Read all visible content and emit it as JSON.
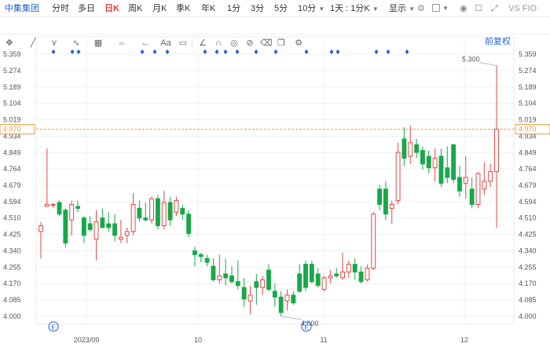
{
  "toolbar": {
    "stock_name": "中集集团",
    "periods": [
      "分时",
      "多日",
      "日K",
      "周K",
      "月K",
      "季K",
      "年K",
      "1分",
      "3分",
      "5分",
      "10分"
    ],
    "active_period": "日K",
    "dropdown_10": "10分",
    "range_select": "1天 : 1分K",
    "show_label": "显示",
    "vs_label": "VS",
    "compare_code": "FIO"
  },
  "draw_tools": {
    "icons": [
      "move-icon",
      "line-icon",
      "channel-icon",
      "wave-icon",
      "grid-icon",
      "arrow-icon",
      "horizontal-line-icon",
      "back-arrow-icon",
      "text-icon",
      "comment-icon",
      "angle-icon",
      "magnet-icon",
      "eye-icon",
      "ban-icon",
      "trash-icon",
      "copy-icon",
      "settings-icon"
    ]
  },
  "adjust_button": "前复权",
  "colors": {
    "up": "#e94545",
    "down": "#18a84a",
    "current_line": "#f39c3c",
    "accent": "#1e62d6"
  },
  "chart_data": {
    "type": "candlestick",
    "yticks": [
      "5.359",
      "5.274",
      "5.189",
      "5.104",
      "5.019",
      "4.934",
      "4.849",
      "4.764",
      "4.679",
      "4.594",
      "4.510",
      "4.425",
      "4.340",
      "4.255",
      "4.170",
      "4.085",
      "4.000"
    ],
    "ylim": [
      4.0,
      5.359
    ],
    "current_price": "4.970",
    "x_labels": [
      "2023/09",
      "10",
      "11",
      "12"
    ],
    "annotations": {
      "high": "5.300",
      "low": "4.000"
    },
    "candles": [
      {
        "o": 4.44,
        "h": 4.49,
        "l": 4.3,
        "c": 4.47
      },
      {
        "o": 4.57,
        "h": 4.87,
        "l": 4.57,
        "c": 4.58
      },
      {
        "o": 4.58,
        "h": 4.59,
        "l": 4.56,
        "c": 4.58
      },
      {
        "o": 4.59,
        "h": 4.6,
        "l": 4.52,
        "c": 4.53
      },
      {
        "o": 4.55,
        "h": 4.56,
        "l": 4.36,
        "c": 4.38
      },
      {
        "o": 4.5,
        "h": 4.6,
        "l": 4.42,
        "c": 4.58
      },
      {
        "o": 4.57,
        "h": 4.6,
        "l": 4.54,
        "c": 4.56
      },
      {
        "o": 4.51,
        "h": 4.52,
        "l": 4.38,
        "c": 4.42
      },
      {
        "o": 4.48,
        "h": 4.52,
        "l": 4.44,
        "c": 4.45
      },
      {
        "o": 4.4,
        "h": 4.55,
        "l": 4.29,
        "c": 4.49
      },
      {
        "o": 4.51,
        "h": 4.56,
        "l": 4.49,
        "c": 4.46
      },
      {
        "o": 4.48,
        "h": 4.54,
        "l": 4.44,
        "c": 4.46
      },
      {
        "o": 4.48,
        "h": 4.53,
        "l": 4.39,
        "c": 4.42
      },
      {
        "o": 4.4,
        "h": 4.5,
        "l": 4.38,
        "c": 4.41
      },
      {
        "o": 4.42,
        "h": 4.46,
        "l": 4.38,
        "c": 4.44
      },
      {
        "o": 4.44,
        "h": 4.64,
        "l": 4.42,
        "c": 4.58
      },
      {
        "o": 4.56,
        "h": 4.6,
        "l": 4.49,
        "c": 4.51
      },
      {
        "o": 4.51,
        "h": 4.59,
        "l": 4.49,
        "c": 4.5
      },
      {
        "o": 4.5,
        "h": 4.62,
        "l": 4.48,
        "c": 4.61
      },
      {
        "o": 4.61,
        "h": 4.63,
        "l": 4.45,
        "c": 4.47
      },
      {
        "o": 4.47,
        "h": 4.65,
        "l": 4.45,
        "c": 4.59
      },
      {
        "o": 4.59,
        "h": 4.62,
        "l": 4.47,
        "c": 4.5
      },
      {
        "o": 4.54,
        "h": 4.62,
        "l": 4.52,
        "c": 4.6
      },
      {
        "o": 4.56,
        "h": 4.58,
        "l": 4.5,
        "c": 4.53
      },
      {
        "o": 4.53,
        "h": 4.55,
        "l": 4.41,
        "c": 4.43
      },
      {
        "o": 4.34,
        "h": 4.36,
        "l": 4.26,
        "c": 4.32
      },
      {
        "o": 4.32,
        "h": 4.33,
        "l": 4.28,
        "c": 4.31
      },
      {
        "o": 4.3,
        "h": 4.32,
        "l": 4.26,
        "c": 4.28
      },
      {
        "o": 4.26,
        "h": 4.3,
        "l": 4.18,
        "c": 4.19
      },
      {
        "o": 4.19,
        "h": 4.32,
        "l": 4.17,
        "c": 4.21
      },
      {
        "o": 4.22,
        "h": 4.3,
        "l": 4.16,
        "c": 4.2
      },
      {
        "o": 4.21,
        "h": 4.26,
        "l": 4.17,
        "c": 4.18
      },
      {
        "o": 4.18,
        "h": 4.29,
        "l": 4.14,
        "c": 4.16
      },
      {
        "o": 4.15,
        "h": 4.2,
        "l": 4.05,
        "c": 4.09
      },
      {
        "o": 4.08,
        "h": 4.16,
        "l": 4.01,
        "c": 4.11
      },
      {
        "o": 4.18,
        "h": 4.22,
        "l": 4.06,
        "c": 4.15
      },
      {
        "o": 4.15,
        "h": 4.21,
        "l": 4.11,
        "c": 4.19
      },
      {
        "o": 4.24,
        "h": 4.27,
        "l": 4.13,
        "c": 4.14
      },
      {
        "o": 4.13,
        "h": 4.17,
        "l": 4.05,
        "c": 4.1
      },
      {
        "o": 4.1,
        "h": 4.13,
        "l": 4.0,
        "c": 4.02
      },
      {
        "o": 4.08,
        "h": 4.14,
        "l": 4.03,
        "c": 4.11
      },
      {
        "o": 4.11,
        "h": 4.13,
        "l": 4.06,
        "c": 4.07
      },
      {
        "o": 4.22,
        "h": 4.27,
        "l": 4.12,
        "c": 4.13
      },
      {
        "o": 4.27,
        "h": 4.29,
        "l": 4.13,
        "c": 4.15
      },
      {
        "o": 4.27,
        "h": 4.29,
        "l": 4.17,
        "c": 4.18
      },
      {
        "o": 4.22,
        "h": 4.25,
        "l": 4.15,
        "c": 4.16
      },
      {
        "o": 4.14,
        "h": 4.21,
        "l": 4.13,
        "c": 4.2
      },
      {
        "o": 4.2,
        "h": 4.24,
        "l": 4.17,
        "c": 4.21
      },
      {
        "o": 4.22,
        "h": 4.25,
        "l": 4.2,
        "c": 4.21
      },
      {
        "o": 4.2,
        "h": 4.33,
        "l": 4.19,
        "c": 4.23
      },
      {
        "o": 4.23,
        "h": 4.29,
        "l": 4.2,
        "c": 4.27
      },
      {
        "o": 4.27,
        "h": 4.3,
        "l": 4.19,
        "c": 4.23
      },
      {
        "o": 4.23,
        "h": 4.26,
        "l": 4.17,
        "c": 4.18
      },
      {
        "o": 4.19,
        "h": 4.27,
        "l": 4.18,
        "c": 4.25
      },
      {
        "o": 4.25,
        "h": 4.54,
        "l": 4.24,
        "c": 4.53
      },
      {
        "o": 4.66,
        "h": 4.68,
        "l": 4.55,
        "c": 4.58
      },
      {
        "o": 4.66,
        "h": 4.7,
        "l": 4.5,
        "c": 4.53
      },
      {
        "o": 4.56,
        "h": 4.6,
        "l": 4.48,
        "c": 4.58
      },
      {
        "o": 4.6,
        "h": 4.9,
        "l": 4.58,
        "c": 4.85
      },
      {
        "o": 4.92,
        "h": 4.98,
        "l": 4.78,
        "c": 4.82
      },
      {
        "o": 4.83,
        "h": 4.99,
        "l": 4.79,
        "c": 4.9
      },
      {
        "o": 4.89,
        "h": 4.92,
        "l": 4.82,
        "c": 4.85
      },
      {
        "o": 4.86,
        "h": 4.88,
        "l": 4.76,
        "c": 4.79
      },
      {
        "o": 4.83,
        "h": 4.86,
        "l": 4.74,
        "c": 4.77
      },
      {
        "o": 4.77,
        "h": 4.87,
        "l": 4.7,
        "c": 4.82
      },
      {
        "o": 4.83,
        "h": 4.87,
        "l": 4.67,
        "c": 4.69
      },
      {
        "o": 4.77,
        "h": 4.88,
        "l": 4.69,
        "c": 4.72
      },
      {
        "o": 4.89,
        "h": 4.89,
        "l": 4.69,
        "c": 4.71
      },
      {
        "o": 4.72,
        "h": 4.78,
        "l": 4.62,
        "c": 4.65
      },
      {
        "o": 4.69,
        "h": 4.83,
        "l": 4.61,
        "c": 4.72
      },
      {
        "o": 4.66,
        "h": 4.72,
        "l": 4.56,
        "c": 4.58
      },
      {
        "o": 4.58,
        "h": 4.75,
        "l": 4.56,
        "c": 4.74
      },
      {
        "o": 4.66,
        "h": 4.8,
        "l": 4.63,
        "c": 4.7
      },
      {
        "o": 4.7,
        "h": 4.79,
        "l": 4.67,
        "c": 4.75
      },
      {
        "o": 4.75,
        "h": 5.3,
        "l": 4.46,
        "c": 4.97
      }
    ]
  }
}
